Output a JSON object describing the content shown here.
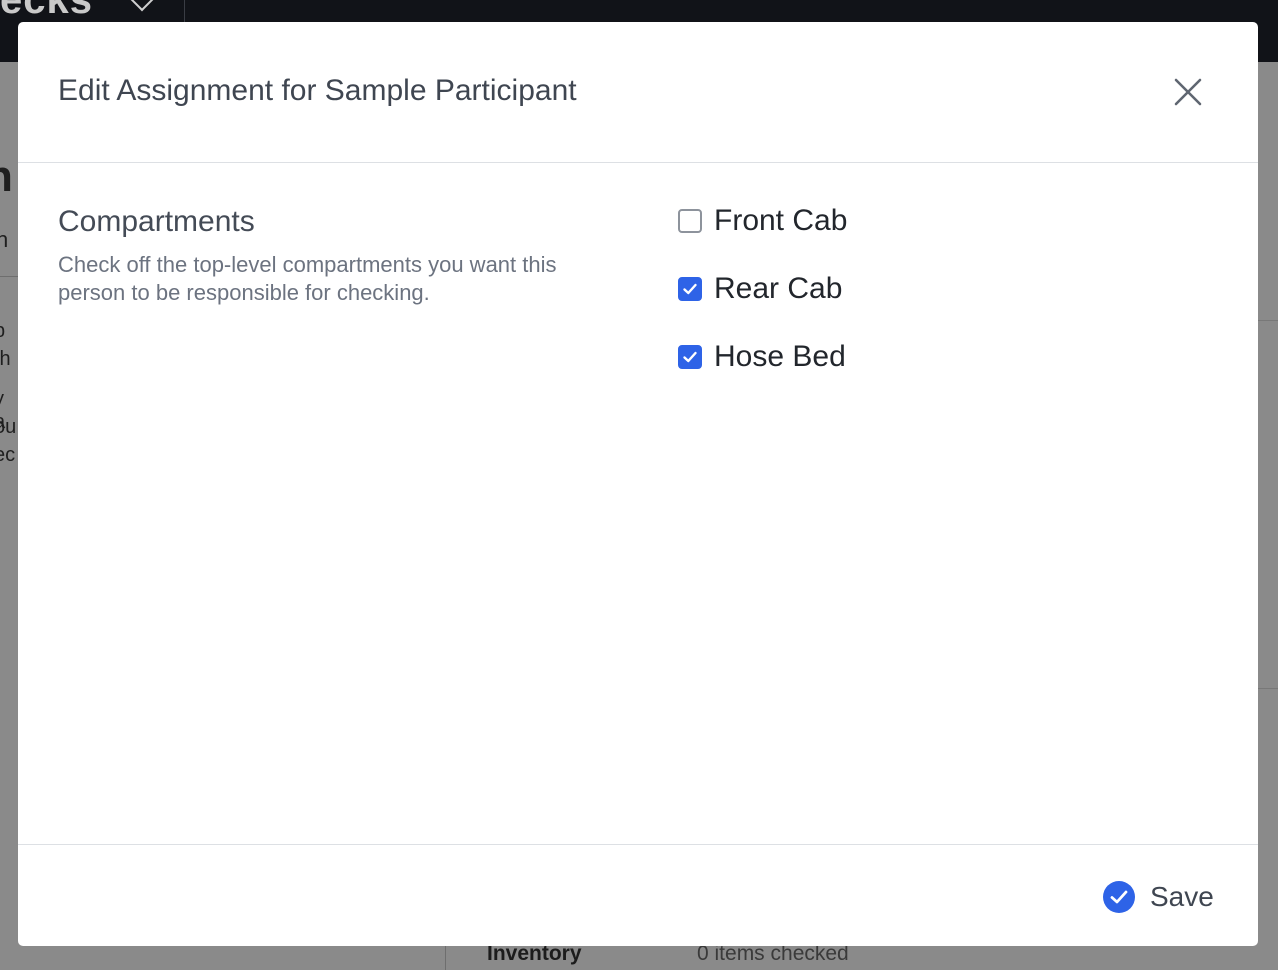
{
  "background": {
    "brand_fragment": "ecks",
    "left_fragments": [
      "n",
      "n",
      "b",
      "th",
      "y a",
      "ou",
      "ec"
    ],
    "bottom_row": {
      "label": "Inventory",
      "value": "0 items checked"
    }
  },
  "modal": {
    "title": "Edit Assignment for Sample Participant",
    "section": {
      "title": "Compartments",
      "help": "Check off the top-level compartments you want this person to be responsible for checking."
    },
    "compartments": [
      {
        "label": "Front Cab",
        "checked": false
      },
      {
        "label": "Rear Cab",
        "checked": true
      },
      {
        "label": "Hose Bed",
        "checked": true
      }
    ],
    "save_label": "Save"
  },
  "colors": {
    "accent": "#2e63e7",
    "title_text": "#3f4651",
    "overlay": "#7a7a7a"
  },
  "icons": {
    "close": "close-icon",
    "check": "checkmark-icon",
    "save": "check-circle-icon",
    "dropdown": "chevron-down-icon"
  }
}
